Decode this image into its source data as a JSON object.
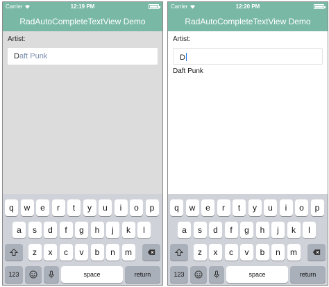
{
  "colors": {
    "accent": "#79b8a4",
    "suggestion_text": "#7d8fb0",
    "caret": "#1e73e8"
  },
  "keyboard_rows": [
    [
      "q",
      "w",
      "e",
      "r",
      "t",
      "y",
      "u",
      "i",
      "o",
      "p"
    ],
    [
      "a",
      "s",
      "d",
      "f",
      "g",
      "h",
      "j",
      "k",
      "l"
    ],
    [
      "z",
      "x",
      "c",
      "v",
      "b",
      "n",
      "m"
    ]
  ],
  "keyboard_labels": {
    "numbers": "123",
    "space": "space",
    "return": "return"
  },
  "keyboard_icons": {
    "shift": "shift-icon",
    "backspace": "backspace-icon",
    "emoji": "emoji-icon",
    "mic": "microphone-icon"
  },
  "screens": [
    {
      "carrier": "Carrier",
      "time": "12:19 PM",
      "title": "RadAutoCompleteTextView Demo",
      "artist_label": "Artist:",
      "input_typed": "D",
      "input_suggestion": "aft Punk",
      "suggestions": []
    },
    {
      "carrier": "Carrier",
      "time": "12:20 PM",
      "title": "RadAutoCompleteTextView Demo",
      "artist_label": "Artist:",
      "input_typed": "D",
      "input_suggestion": "",
      "suggestions": [
        "Daft Punk"
      ]
    }
  ]
}
